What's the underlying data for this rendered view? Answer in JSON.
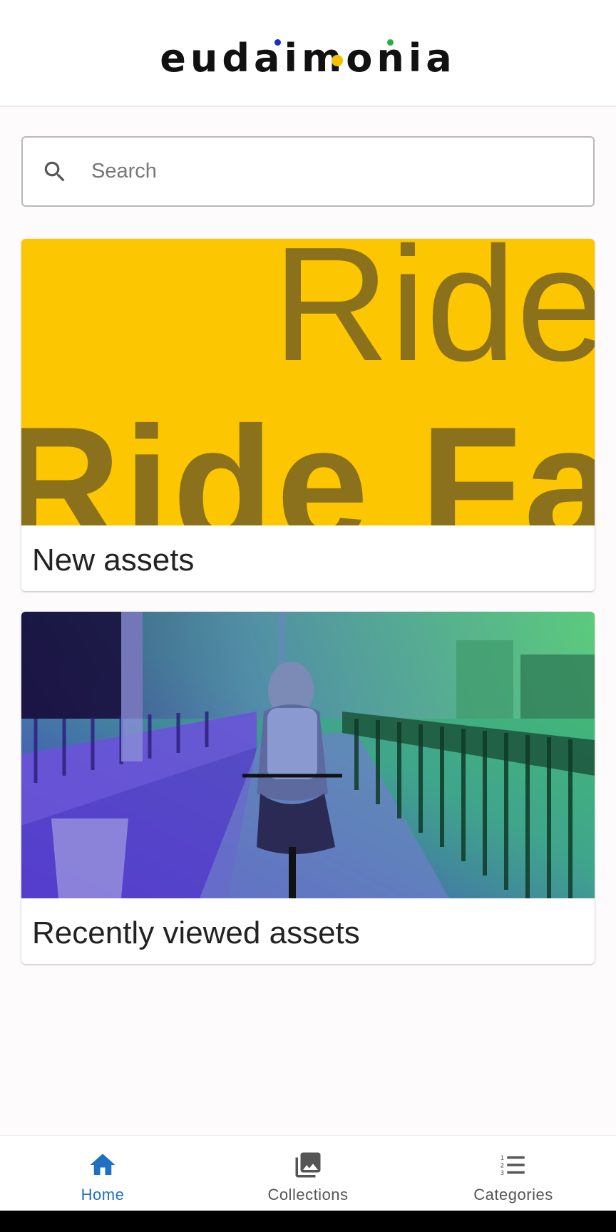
{
  "header": {
    "logo_text": "eudaimonia",
    "logo_dot_colors": [
      "#1a2ad6",
      "#f2c200",
      "#26b04a"
    ]
  },
  "search": {
    "placeholder": "Search",
    "value": "",
    "icon": "search-icon"
  },
  "cards": [
    {
      "title": "New assets",
      "image": {
        "description_text_top": "Ride",
        "description_text_bottom": "Ride Fas",
        "background_color": "#fcc600"
      }
    },
    {
      "title": "Recently viewed assets",
      "image": {
        "gradient_colors": [
          "#4a2fd0",
          "#3fa48c",
          "#43c46b"
        ]
      }
    }
  ],
  "bottom_nav": {
    "items": [
      {
        "label": "Home",
        "icon": "home-icon",
        "active": true
      },
      {
        "label": "Collections",
        "icon": "collections-icon",
        "active": false
      },
      {
        "label": "Categories",
        "icon": "categories-icon",
        "active": false
      }
    ],
    "active_color": "#1f6fc2",
    "inactive_color": "#555555"
  }
}
